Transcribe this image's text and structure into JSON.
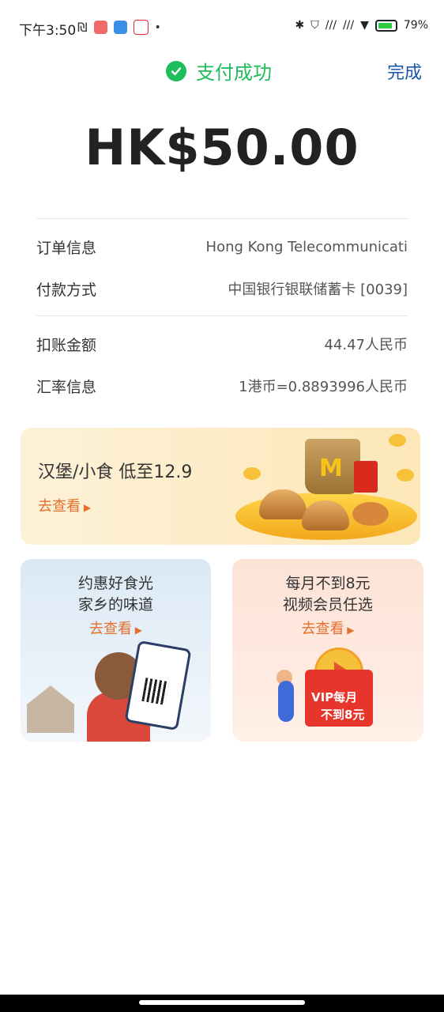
{
  "status_bar": {
    "time": "下午3:50",
    "battery": "79%",
    "battery_level": 0.79
  },
  "header": {
    "title": "支付成功",
    "done_label": "完成"
  },
  "payment": {
    "amount": "HK$50.00"
  },
  "details": [
    {
      "label": "订单信息",
      "value": "Hong Kong Telecommunicati"
    },
    {
      "label": "付款方式",
      "value": "中国银行银联储蓄卡 [0039]"
    },
    {
      "label": "扣账金额",
      "value": "44.47人民币"
    },
    {
      "label": "汇率信息",
      "value": "1港币=0.8893996人民币"
    }
  ],
  "promos": {
    "main": {
      "title": "汉堡/小食 低至12.9",
      "cta": "去查看"
    },
    "left": {
      "line1": "约惠好食光",
      "line2": "家乡的味道",
      "cta": "去查看"
    },
    "right": {
      "line1": "每月不到8元",
      "line2": "视频会员任选",
      "cta": "去查看",
      "badge1": "VIP每月",
      "badge2": "不到8元"
    }
  },
  "colors": {
    "success": "#1fbd5c",
    "link": "#1a56a8",
    "cta": "#e66f2c"
  }
}
